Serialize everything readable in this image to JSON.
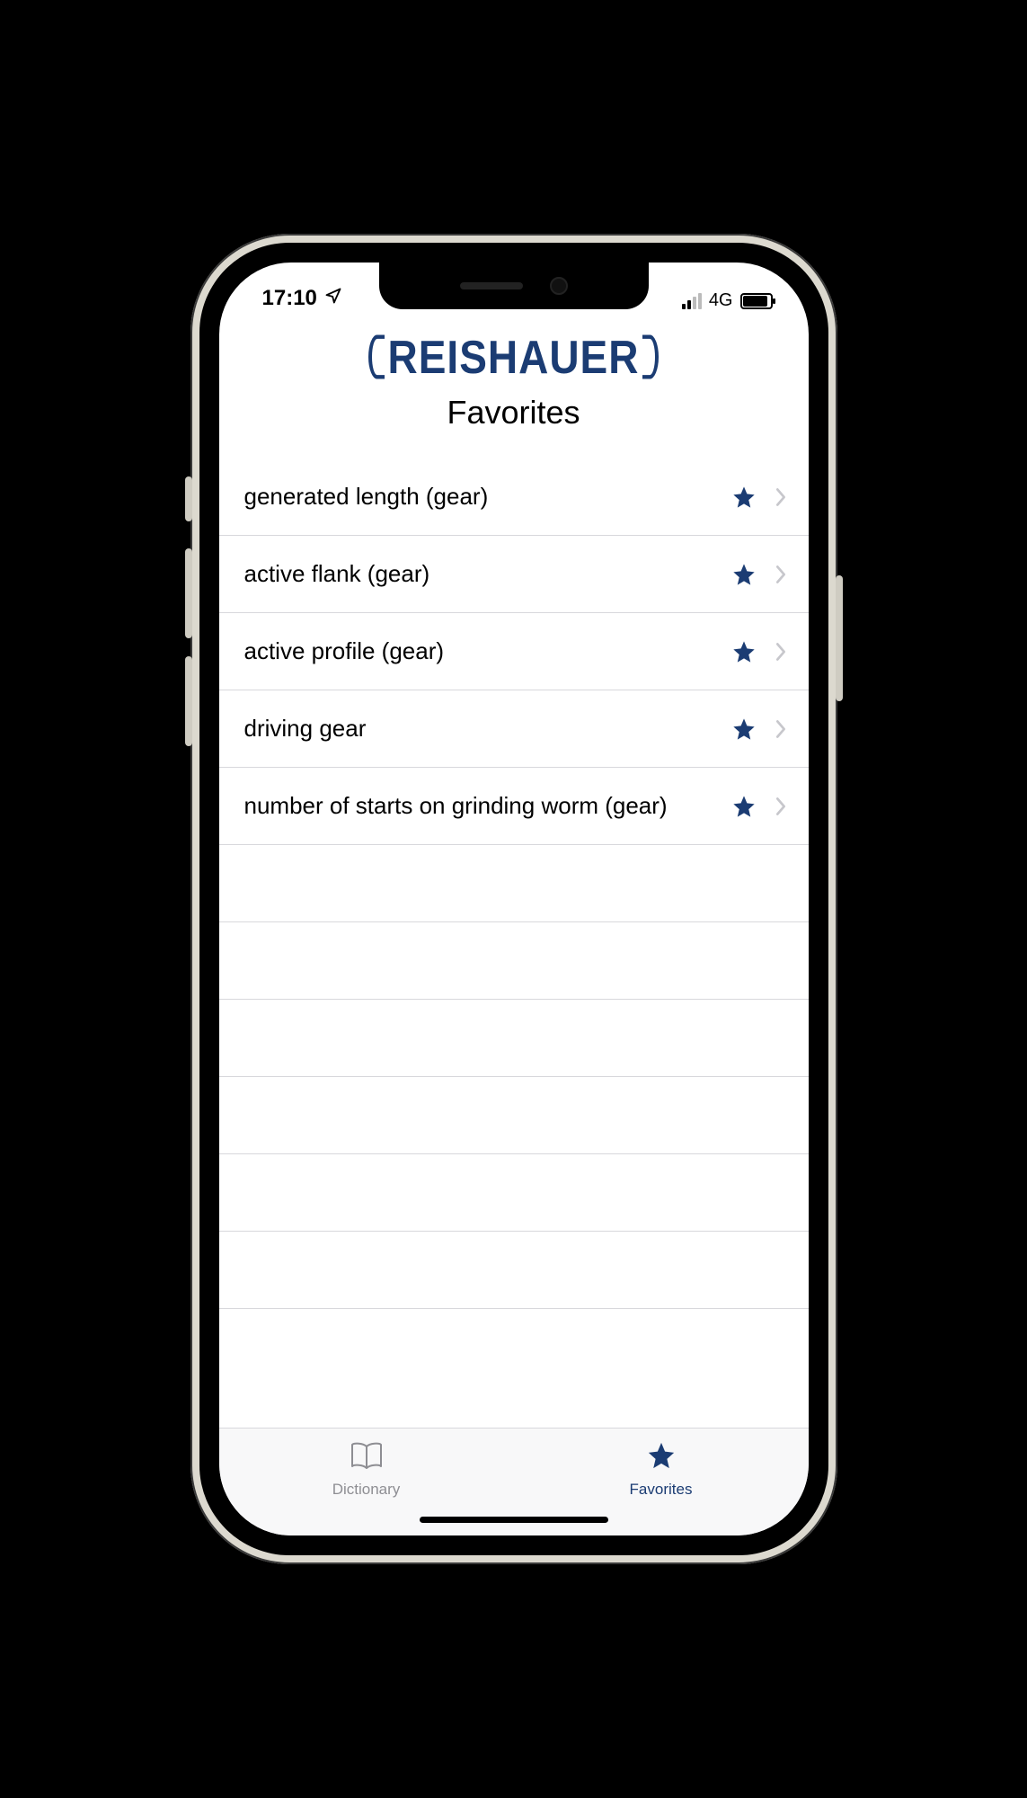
{
  "status": {
    "time": "17:10",
    "network_label": "4G"
  },
  "header": {
    "brand": "REISHAUER",
    "title": "Favorites"
  },
  "favorites": [
    {
      "label": "generated length (gear)"
    },
    {
      "label": "active flank (gear)"
    },
    {
      "label": "active profile (gear)"
    },
    {
      "label": "driving gear"
    },
    {
      "label": "number of starts on grinding worm (gear)"
    }
  ],
  "tabs": {
    "dictionary": "Dictionary",
    "favorites": "Favorites"
  }
}
